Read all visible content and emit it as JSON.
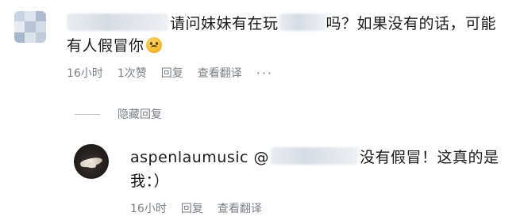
{
  "comment": {
    "avatar_colors": [
      "#c9d3e2",
      "#dfe5ee",
      "#aebbd0",
      "#e7ebf1",
      "#b9c5d6",
      "#d3dbe6",
      "#a8b6cb",
      "#dbe2ea",
      "#c0ccdb"
    ],
    "text_part1": "请问妹妹有在玩",
    "text_part2": "吗？如果没有的话，可能有人假冒你",
    "emoji": "sad-face-emoji",
    "time": "16小时",
    "likes": "1次赞",
    "reply": "回复",
    "translate": "查看翻译",
    "more": "···"
  },
  "hide_replies": {
    "label": "隐藏回复"
  },
  "reply": {
    "username": "aspenlaumusic",
    "at_symbol": "@",
    "text": "没有假冒！这真的是我：）",
    "time": "16小时",
    "reply": "回复",
    "translate": "查看翻译"
  }
}
